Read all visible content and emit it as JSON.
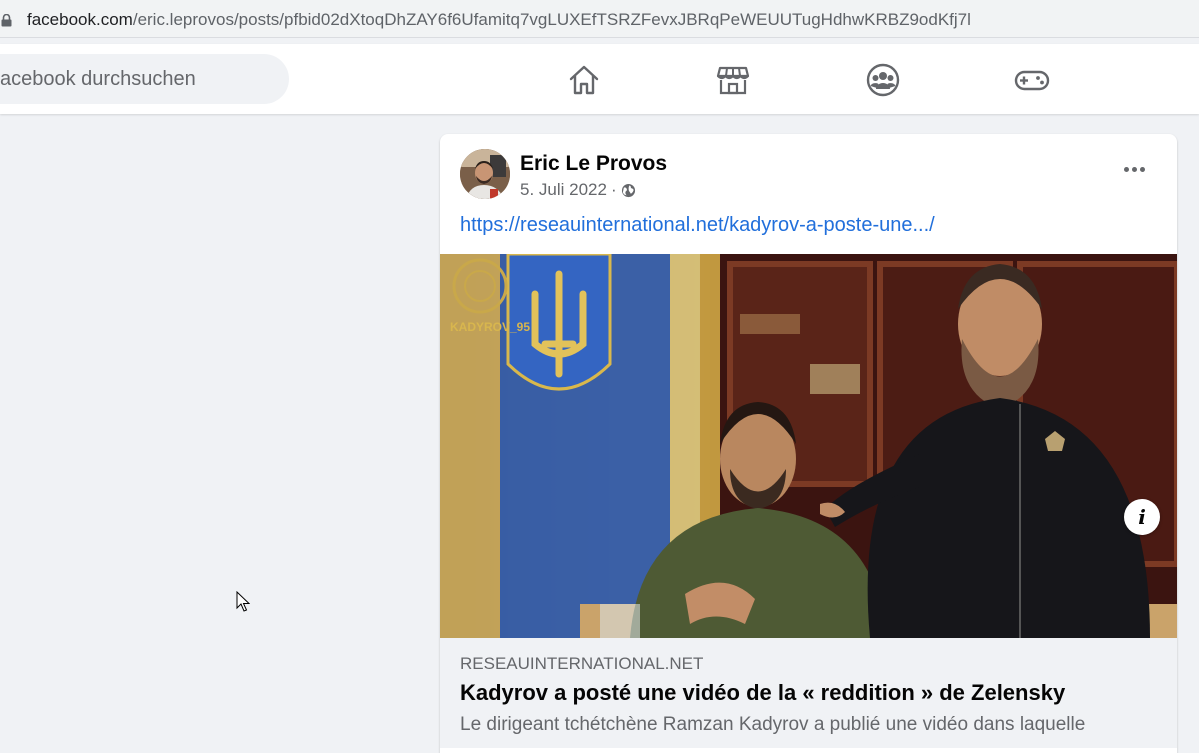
{
  "browser": {
    "url_host": "facebook.com",
    "url_path": "/eric.leprovos/posts/pfbid02dXtoqDhZAY6f6Ufamitq7vgLUXEfTSRZFevxJBRqPeWEUUTugHdhwKRBZ9odKfj7l"
  },
  "topnav": {
    "search_placeholder": "acebook durchsuchen",
    "icons": [
      "home-icon",
      "marketplace-icon",
      "groups-icon",
      "gaming-icon"
    ]
  },
  "post": {
    "author": "Eric Le Provos",
    "date": "5. Juli 2022",
    "separator": "·",
    "privacy_icon": "globe-icon",
    "link_text": "https://reseauinternational.net/kadyrov-a-poste-une.../",
    "image_watermark": "KADYROV_95",
    "link_preview": {
      "domain": "RESEAUINTERNATIONAL.NET",
      "title": "Kadyrov a posté une vidéo de la « reddition » de Zelensky",
      "description": "Le dirigeant tchétchène Ramzan Kadyrov a publié une vidéo dans laquelle"
    }
  },
  "colors": {
    "background": "#f0f2f5",
    "link": "#216fdb",
    "secondary_text": "#65676b"
  }
}
